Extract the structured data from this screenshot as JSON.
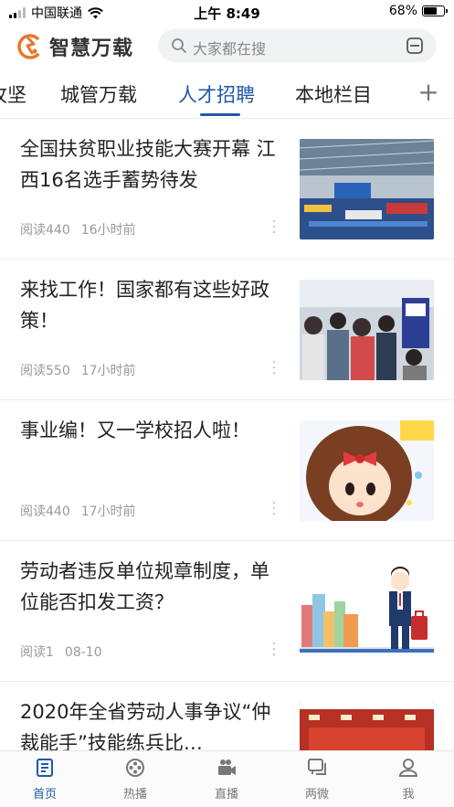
{
  "status_bar": {
    "carrier": "中国联通",
    "time": "上午 8:49",
    "battery_percent": "68%",
    "battery_level": 0.68
  },
  "header": {
    "app_name": "智慧万载",
    "logo_icon": "wanzai-logo-icon",
    "search_placeholder": "大家都在搜",
    "scan_icon": "scan-icon"
  },
  "tabs": {
    "items": [
      {
        "label": "攻坚"
      },
      {
        "label": "城管万载"
      },
      {
        "label": "人才招聘"
      },
      {
        "label": "本地栏目"
      }
    ],
    "active": "人才招聘",
    "add_label": "+"
  },
  "articles": [
    {
      "title": "全国扶贫职业技能大赛开幕 江西16名选手蓄势待发",
      "reads": "阅读440",
      "time": "16小时前",
      "image": "competition-hall-photo"
    },
    {
      "title": "来找工作！国家都有这些好政策！",
      "reads": "阅读550",
      "time": "17小时前",
      "image": "job-fair-crowd-photo"
    },
    {
      "title": "事业编！又一学校招人啦！",
      "reads": "阅读440",
      "time": "17小时前",
      "image": "cartoon-girl-bow-illustration"
    },
    {
      "title": "劳动者违反单位规章制度，单位能否扣发工资？",
      "reads": "阅读1",
      "time": "08-10",
      "image": "businessman-suitcase-illustration"
    },
    {
      "title": "2020年全省劳动人事争议“仲裁能手”技能练兵比…",
      "reads": "",
      "time": "",
      "image": "conference-stage-photo"
    }
  ],
  "bottom_nav": {
    "items": [
      {
        "label": "首页",
        "icon": "home-icon"
      },
      {
        "label": "热播",
        "icon": "film-reel-icon"
      },
      {
        "label": "直播",
        "icon": "video-camera-icon"
      },
      {
        "label": "两微",
        "icon": "chat-bubble-icon"
      },
      {
        "label": "我",
        "icon": "user-icon"
      }
    ],
    "active": "首页"
  },
  "colors": {
    "accent": "#1f5aa8",
    "logo_orange": "#e8772e",
    "meta_gray": "#999999"
  }
}
